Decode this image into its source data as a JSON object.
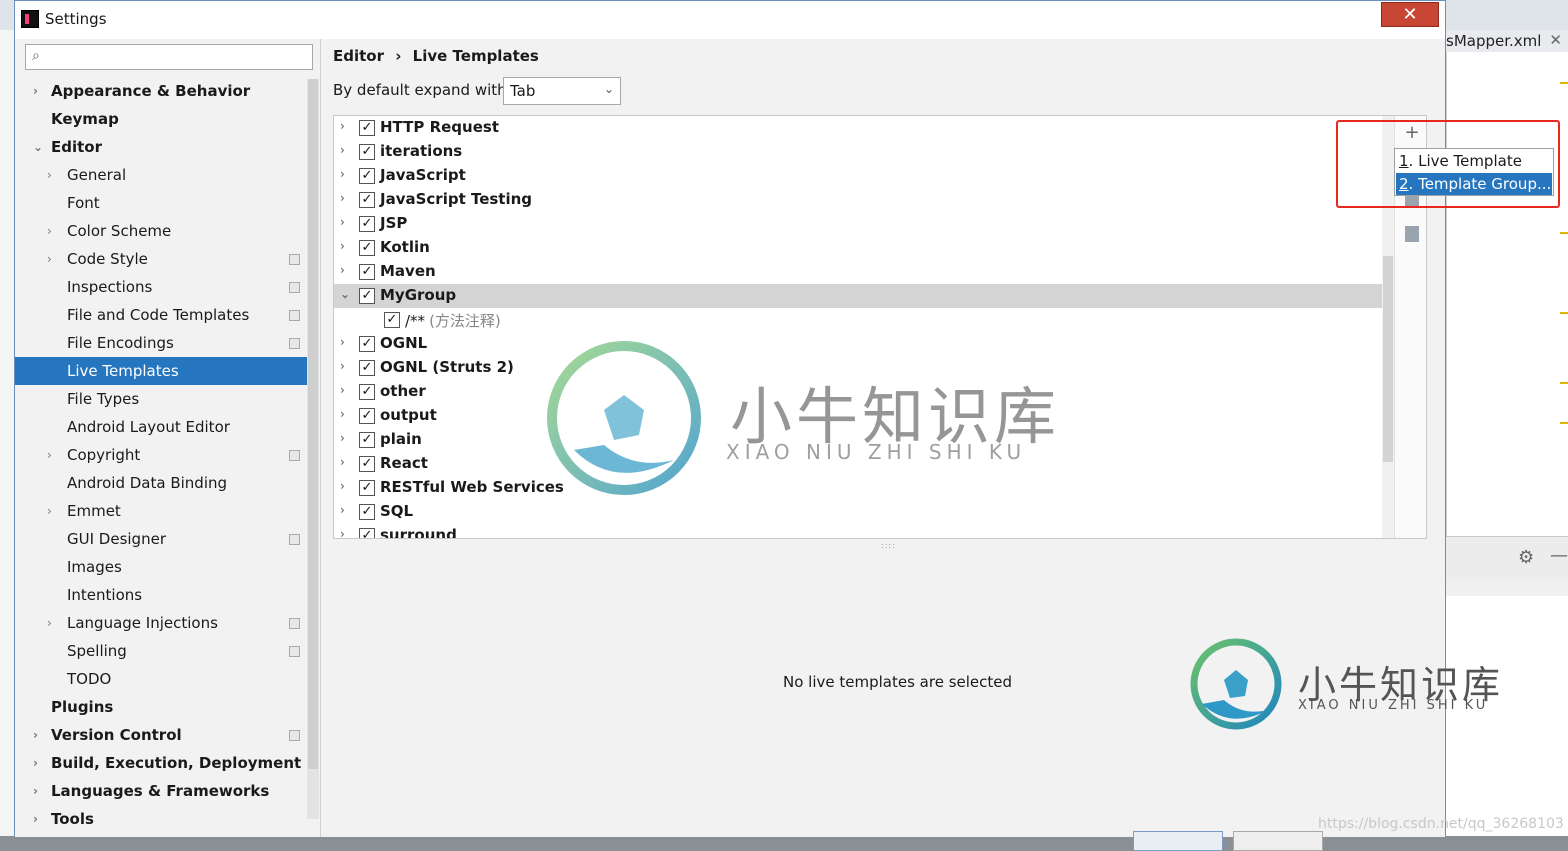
{
  "window": {
    "title": "Settings",
    "close_glyph": "✕"
  },
  "background": {
    "tab_label": "sMapper.xml",
    "tab_close": "✕",
    "gear_glyph": "⚙",
    "minus_glyph": "—"
  },
  "search": {
    "value": "",
    "placeholder": "",
    "icon": "search-icon"
  },
  "sidebar": {
    "items": [
      {
        "label": "Appearance & Behavior",
        "arrow": "›",
        "bold": true
      },
      {
        "label": "Keymap",
        "arrow": "",
        "bold": true
      },
      {
        "label": "Editor",
        "arrow": "⌄",
        "bold": true
      },
      {
        "label": "General",
        "arrow": "›"
      },
      {
        "label": "Font",
        "arrow": ""
      },
      {
        "label": "Color Scheme",
        "arrow": "›"
      },
      {
        "label": "Code Style",
        "arrow": "›",
        "cfg": true
      },
      {
        "label": "Inspections",
        "arrow": "",
        "cfg": true
      },
      {
        "label": "File and Code Templates",
        "arrow": "",
        "cfg": true
      },
      {
        "label": "File Encodings",
        "arrow": "",
        "cfg": true
      },
      {
        "label": "Live Templates",
        "arrow": "",
        "selected": true
      },
      {
        "label": "File Types",
        "arrow": ""
      },
      {
        "label": "Android Layout Editor",
        "arrow": ""
      },
      {
        "label": "Copyright",
        "arrow": "›",
        "cfg": true
      },
      {
        "label": "Android Data Binding",
        "arrow": ""
      },
      {
        "label": "Emmet",
        "arrow": "›"
      },
      {
        "label": "GUI Designer",
        "arrow": "",
        "cfg": true
      },
      {
        "label": "Images",
        "arrow": ""
      },
      {
        "label": "Intentions",
        "arrow": ""
      },
      {
        "label": "Language Injections",
        "arrow": "›",
        "cfg": true
      },
      {
        "label": "Spelling",
        "arrow": "",
        "cfg": true
      },
      {
        "label": "TODO",
        "arrow": ""
      },
      {
        "label": "Plugins",
        "arrow": "",
        "bold": true
      },
      {
        "label": "Version Control",
        "arrow": "›",
        "bold": true,
        "cfg": true
      },
      {
        "label": "Build, Execution, Deployment",
        "arrow": "›",
        "bold": true
      },
      {
        "label": "Languages & Frameworks",
        "arrow": "›",
        "bold": true
      },
      {
        "label": "Tools",
        "arrow": "›",
        "bold": true
      }
    ]
  },
  "breadcrumb": {
    "part1": "Editor",
    "separator": "›",
    "part2": "Live Templates"
  },
  "expand": {
    "label": "By default expand with",
    "value": "Tab",
    "chevron": "⌄"
  },
  "templates": {
    "groups": [
      {
        "name": "HTTP Request",
        "checked": true
      },
      {
        "name": "iterations",
        "checked": true
      },
      {
        "name": "JavaScript",
        "checked": true
      },
      {
        "name": "JavaScript Testing",
        "checked": true
      },
      {
        "name": "JSP",
        "checked": true
      },
      {
        "name": "Kotlin",
        "checked": true
      },
      {
        "name": "Maven",
        "checked": true
      },
      {
        "name": "MyGroup",
        "checked": true,
        "expanded": true,
        "selected": true
      },
      {
        "name": "/**",
        "desc": "(方法注释)",
        "checked": true,
        "child": true
      },
      {
        "name": "OGNL",
        "checked": true
      },
      {
        "name": "OGNL (Struts 2)",
        "checked": true
      },
      {
        "name": "other",
        "checked": true
      },
      {
        "name": "output",
        "checked": true
      },
      {
        "name": "plain",
        "checked": true
      },
      {
        "name": "React",
        "checked": true
      },
      {
        "name": "RESTful Web Services",
        "checked": true
      },
      {
        "name": "SQL",
        "checked": true
      },
      {
        "name": "surround",
        "checked": true
      }
    ],
    "check_glyph": "✓",
    "collapsed_arrow": "›",
    "expanded_arrow": "⌄"
  },
  "toolbar": {
    "add_glyph": "+"
  },
  "popup": {
    "items": [
      {
        "number": "1",
        "label": ". Live Template"
      },
      {
        "number": "2",
        "label": ". Template Group..."
      }
    ]
  },
  "status": {
    "empty_message": "No live templates are selected",
    "splitter": "::::"
  },
  "watermark": {
    "brand": "小牛知识库",
    "brand_pinyin": "XIAO NIU ZHI SHI KU",
    "url": "https://blog.csdn.net/qq_36268103"
  },
  "colors": {
    "selection": "#2675bf",
    "highlight_box": "#e8281e",
    "row_selected": "#d4d4d4"
  }
}
